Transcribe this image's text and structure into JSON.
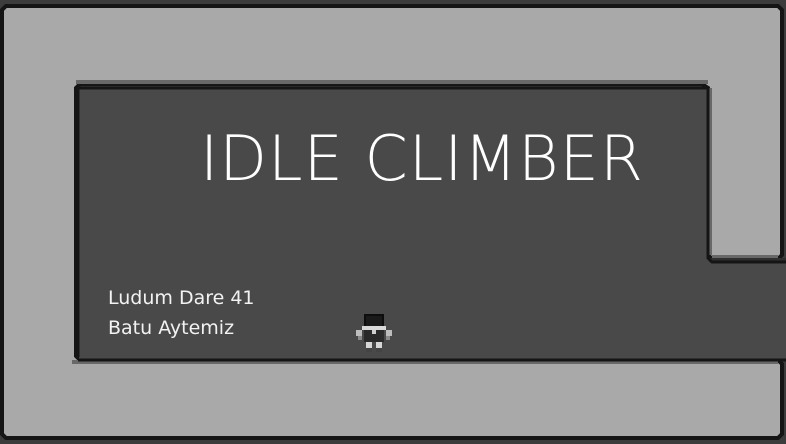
{
  "game": {
    "title": "IDLE CLIMBER",
    "credit_event": "Ludum Dare 41",
    "credit_author": "Batu Aytemiz"
  },
  "colors": {
    "wall": "#a9a9a9",
    "wall_edge": "#151515",
    "wall_shadow": "#686868",
    "room_floor": "#494949",
    "text": "#ffffff"
  },
  "sprites": {
    "player": "climber-character"
  }
}
